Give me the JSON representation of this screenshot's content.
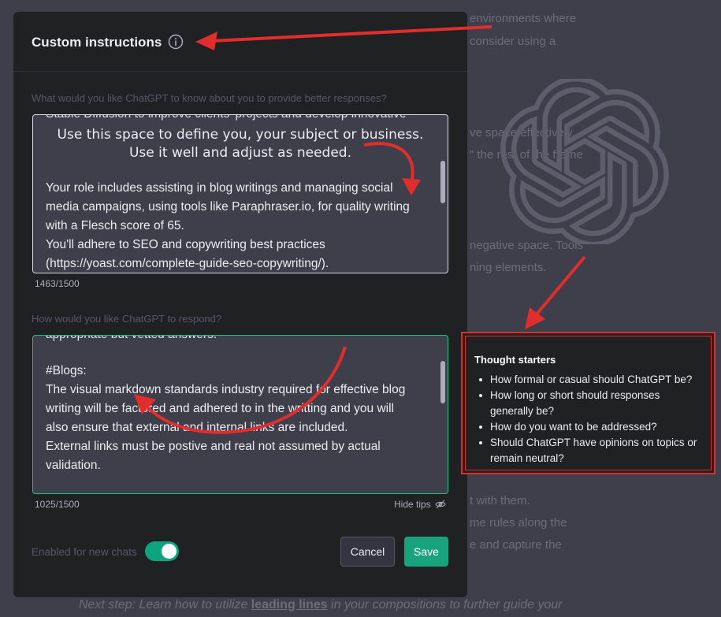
{
  "background": {
    "lines": [
      "environments where",
      "consider using a",
      "ve space effectively.",
      "\" the rest of the frame",
      "negative space. Tools",
      "ning elements.",
      "t with them.",
      "me rules along the",
      "e and capture the"
    ],
    "next_step_prefix": "Next step:",
    "next_step_middle": " Learn how to utilize ",
    "next_step_link": "leading lines",
    "next_step_suffix": " in your compositions to further guide your"
  },
  "modal": {
    "title": "Custom instructions",
    "info_icon": "info-icon",
    "about": {
      "label": "What would you like ChatGPT to know about you to provide better responses?",
      "partial_top_line": "Stable Diffusion to improve clients' projects and develop innovative",
      "note_line1": "Use this space to define you, your subject or business.",
      "note_line2": "Use it well and adjust as needed.",
      "lines": [
        "Your role includes assisting in blog writings and managing social",
        "media campaigns, using tools like Paraphraser.io,  for quality writing",
        "with a Flesch score of 65.",
        "You'll adhere to SEO and copywriting best practices",
        "(https://yoast.com/complete-guide-seo-copywriting/)."
      ],
      "counter": "1463/1500"
    },
    "respond": {
      "label": "How would you like ChatGPT to respond?",
      "partial_top_line": "appropriate but vetted answers.",
      "lines": [
        "#Blogs:",
        "The visual markdown standards industry required for effective blog",
        "writing will be factored and adhered to in the writting and you will",
        "also ensure that external and internal links are included.",
        "External links must be postive and real not assumed by actual",
        "validation."
      ],
      "counter": "1025/1500"
    },
    "hide_tips": "Hide tips",
    "enabled_label": "Enabled for new chats",
    "toggle_on": true,
    "cancel_label": "Cancel",
    "save_label": "Save"
  },
  "tips": {
    "title": "Thought starters",
    "items": [
      "How formal or casual should ChatGPT be?",
      "How long or short should responses generally be?",
      "How do you want to be addressed?",
      "Should ChatGPT have opinions on topics or remain neutral?"
    ]
  },
  "colors": {
    "accent_green": "#19c37d",
    "save_green": "#19a37d",
    "annotation_red": "#e22d2d",
    "modal_bg": "#202123",
    "page_bg": "#3e3f4b"
  }
}
